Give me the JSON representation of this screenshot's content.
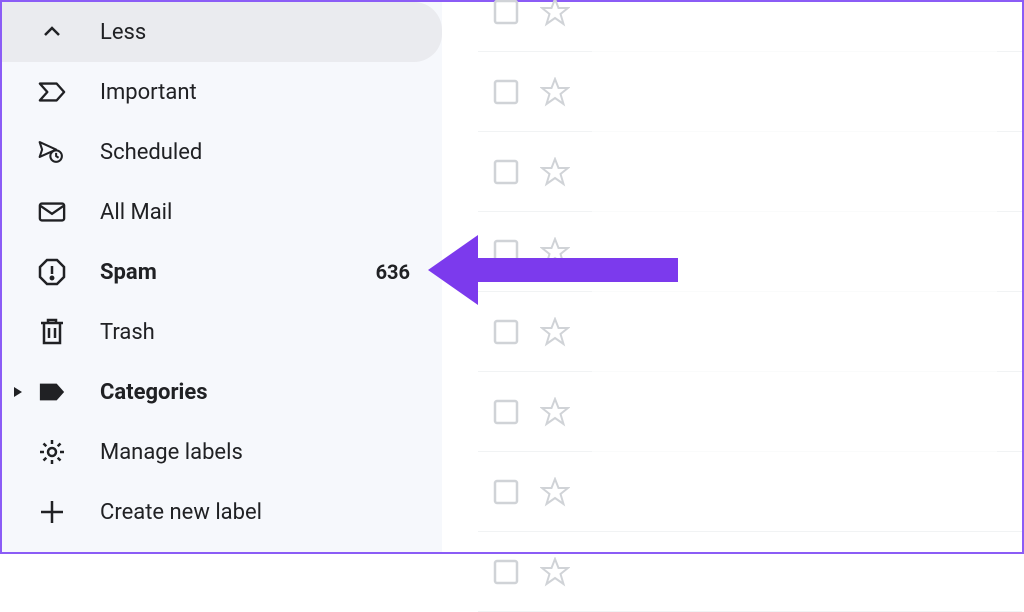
{
  "sidebar": {
    "items": [
      {
        "label": "Less",
        "icon": "chevron-up",
        "highlighted": true
      },
      {
        "label": "Important",
        "icon": "important"
      },
      {
        "label": "Scheduled",
        "icon": "scheduled"
      },
      {
        "label": "All Mail",
        "icon": "all-mail"
      },
      {
        "label": "Spam",
        "icon": "spam",
        "bold": true,
        "count": "636"
      },
      {
        "label": "Trash",
        "icon": "trash"
      },
      {
        "label": "Categories",
        "icon": "label",
        "bold": true,
        "hasChevron": true
      },
      {
        "label": "Manage labels",
        "icon": "gear"
      },
      {
        "label": "Create new label",
        "icon": "plus"
      }
    ]
  },
  "emailRows": 7,
  "annotation": {
    "arrowColor": "#7c3aed"
  }
}
